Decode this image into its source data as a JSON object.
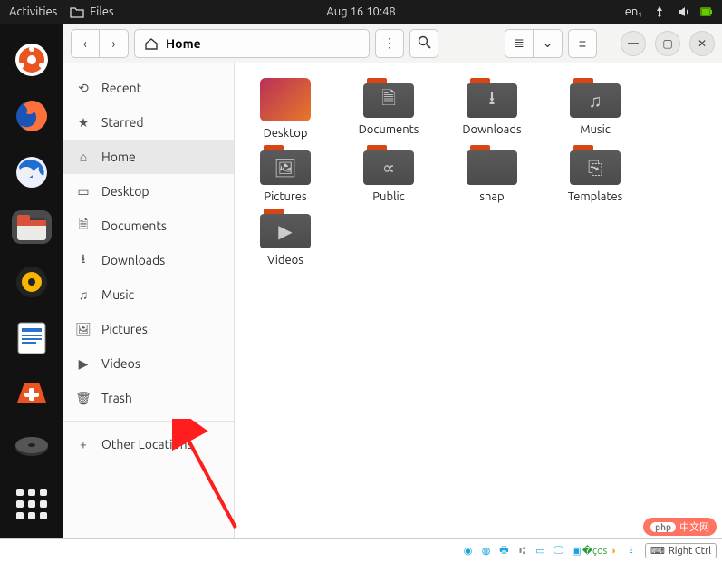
{
  "menubar": {
    "activities": "Activities",
    "app_label": "Files",
    "datetime": "Aug 16  10:48",
    "input_source": "en₁"
  },
  "dock": {
    "items": [
      {
        "name": "yaru-settings",
        "color": "#e95420"
      },
      {
        "name": "firefox",
        "color": "#ff7139"
      },
      {
        "name": "thunderbird",
        "color": "#1f6fd0"
      },
      {
        "name": "files",
        "color": "#d9533c",
        "active": true
      },
      {
        "name": "rhythmbox",
        "color": "#f7b500"
      },
      {
        "name": "libreoffice-writer",
        "color": "#2a73c9"
      },
      {
        "name": "ubuntu-software",
        "color": "#e95420"
      },
      {
        "name": "disk",
        "color": "#555"
      }
    ]
  },
  "window": {
    "path_label": "Home",
    "toolbar": {
      "back": "‹",
      "forward": "›",
      "menu": "⋮",
      "search": "🔍",
      "list_view": "≣",
      "view_opts": "⌄",
      "hamburger": "≡",
      "minimize": "—",
      "maximize": "▢",
      "close": "✕"
    }
  },
  "sidebar": {
    "items": [
      {
        "icon": "⟲",
        "label": "Recent",
        "name": "recent"
      },
      {
        "icon": "★",
        "label": "Starred",
        "name": "starred"
      },
      {
        "icon": "⌂",
        "label": "Home",
        "name": "home",
        "selected": true
      },
      {
        "icon": "▭",
        "label": "Desktop",
        "name": "desktop"
      },
      {
        "icon": "🗎",
        "label": "Documents",
        "name": "documents"
      },
      {
        "icon": "⭳",
        "label": "Downloads",
        "name": "downloads"
      },
      {
        "icon": "♫",
        "label": "Music",
        "name": "music"
      },
      {
        "icon": "🖼",
        "label": "Pictures",
        "name": "pictures"
      },
      {
        "icon": "▶",
        "label": "Videos",
        "name": "videos"
      },
      {
        "icon": "🗑",
        "label": "Trash",
        "name": "trash"
      }
    ],
    "other_locations": {
      "icon": "+",
      "label": "Other Locations"
    }
  },
  "files": [
    {
      "label": "Desktop",
      "type": "desktop"
    },
    {
      "label": "Documents",
      "type": "folder",
      "glyph": "🗎"
    },
    {
      "label": "Downloads",
      "type": "folder",
      "glyph": "⭳"
    },
    {
      "label": "Music",
      "type": "folder",
      "glyph": "♫"
    },
    {
      "label": "Pictures",
      "type": "folder",
      "glyph": "🖼"
    },
    {
      "label": "Public",
      "type": "folder",
      "glyph": "∝"
    },
    {
      "label": "snap",
      "type": "folder",
      "glyph": ""
    },
    {
      "label": "Templates",
      "type": "folder",
      "glyph": "⎘"
    },
    {
      "label": "Videos",
      "type": "folder",
      "glyph": "▶"
    }
  ],
  "annotation": {
    "target": "Other Locations"
  },
  "watermark": {
    "badge": "php",
    "text": "中文网"
  },
  "vbox": {
    "hostkey": "Right Ctrl"
  }
}
